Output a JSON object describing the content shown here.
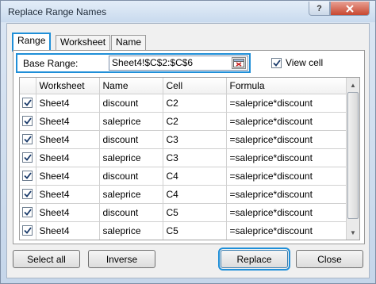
{
  "window": {
    "title": "Replace Range Names",
    "help_label": "?"
  },
  "tabs": [
    {
      "label": "Range",
      "active": true
    },
    {
      "label": "Worksheet",
      "active": false
    },
    {
      "label": "Name",
      "active": false
    }
  ],
  "base_range": {
    "label": "Base Range:",
    "value": "Sheet4!$C$2:$C$6"
  },
  "view_cell": {
    "label": "View cell",
    "checked": true
  },
  "grid": {
    "columns": [
      "",
      "Worksheet",
      "Name",
      "Cell",
      "Formula"
    ],
    "rows": [
      {
        "checked": true,
        "worksheet": "Sheet4",
        "name": "discount",
        "cell": "C2",
        "formula": "=saleprice*discount"
      },
      {
        "checked": true,
        "worksheet": "Sheet4",
        "name": "saleprice",
        "cell": "C2",
        "formula": "=saleprice*discount"
      },
      {
        "checked": true,
        "worksheet": "Sheet4",
        "name": "discount",
        "cell": "C3",
        "formula": "=saleprice*discount"
      },
      {
        "checked": true,
        "worksheet": "Sheet4",
        "name": "saleprice",
        "cell": "C3",
        "formula": "=saleprice*discount"
      },
      {
        "checked": true,
        "worksheet": "Sheet4",
        "name": "discount",
        "cell": "C4",
        "formula": "=saleprice*discount"
      },
      {
        "checked": true,
        "worksheet": "Sheet4",
        "name": "saleprice",
        "cell": "C4",
        "formula": "=saleprice*discount"
      },
      {
        "checked": true,
        "worksheet": "Sheet4",
        "name": "discount",
        "cell": "C5",
        "formula": "=saleprice*discount"
      },
      {
        "checked": true,
        "worksheet": "Sheet4",
        "name": "saleprice",
        "cell": "C5",
        "formula": "=saleprice*discount"
      }
    ]
  },
  "buttons": {
    "select_all": "Select all",
    "inverse": "Inverse",
    "replace": "Replace",
    "close": "Close"
  },
  "colors": {
    "highlight": "#1f8fd8"
  },
  "icons": [
    "close-icon",
    "help-icon",
    "range-picker-icon",
    "checkbox-check-icon",
    "scroll-up-icon",
    "scroll-down-icon"
  ]
}
